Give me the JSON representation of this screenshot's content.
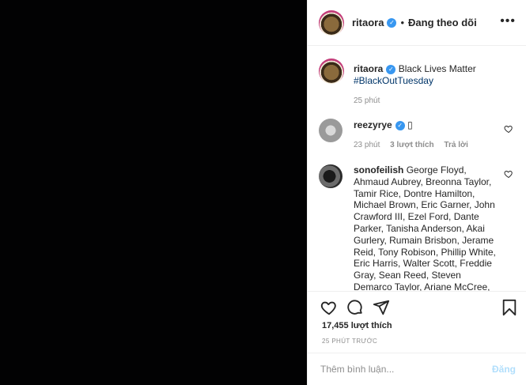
{
  "header": {
    "username": "ritaora",
    "separator": "•",
    "follow_label": "Đang theo dõi",
    "more_label": "•••"
  },
  "caption": {
    "username": "ritaora",
    "text": "Black Lives Matter",
    "hashtag": "#BlackOutTuesday",
    "time": "25 phút"
  },
  "comments": [
    {
      "username": "reezyrye",
      "text": "▯",
      "time": "23 phút",
      "likes": "3 lượt thích",
      "reply": "Trả lời"
    },
    {
      "username": "sonofeilish",
      "text": "George Floyd, Ahmaud Aubrey, Breonna Taylor, Tamir Rice, Dontre Hamilton, Michael Brown, Eric Garner, John Crawford III, Ezel Ford, Dante Parker, Tanisha Anderson, Akai Gurlery, Rumain Brisbon, Jerame Reid, Tony Robison, Phillip White, Eric Harris, Walter Scott, Freddie Gray, Sean Reed, Steven Demarco Taylor, Ariane McCree, Terrance"
    }
  ],
  "stats": {
    "likes": "17,455 lượt thích",
    "time_ago": "25 PHÚT TRƯỚC"
  },
  "add_comment": {
    "placeholder": "Thêm bình luận...",
    "post_label": "Đăng"
  },
  "icons": [
    "heart-icon",
    "comment-icon",
    "share-icon",
    "bookmark-icon",
    "verified-icon",
    "more-icon"
  ]
}
